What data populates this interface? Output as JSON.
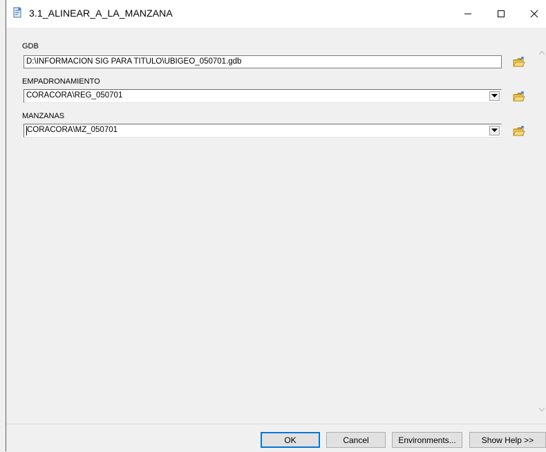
{
  "window": {
    "title": "3.1_ALINEAR_A_LA_MANZANA",
    "icons": [
      "script-tool-icon",
      "minimize-icon",
      "maximize-icon",
      "close-icon"
    ]
  },
  "fields": {
    "gdb": {
      "label": "GDB",
      "value": "D:\\INFORMACION SIG PARA TITULO\\UBIGEO_050701.gdb"
    },
    "empadronamiento": {
      "label": "EMPADRONAMIENTO",
      "value": "CORACORA\\REG_050701"
    },
    "manzanas": {
      "label": "MANZANAS",
      "value": "CORACORA\\MZ_050701"
    }
  },
  "buttons": {
    "ok": "OK",
    "cancel": "Cancel",
    "environments": "Environments...",
    "show_help": "Show Help >>"
  },
  "colors": {
    "accent": "#0078d7",
    "folder": "#e8b936"
  }
}
